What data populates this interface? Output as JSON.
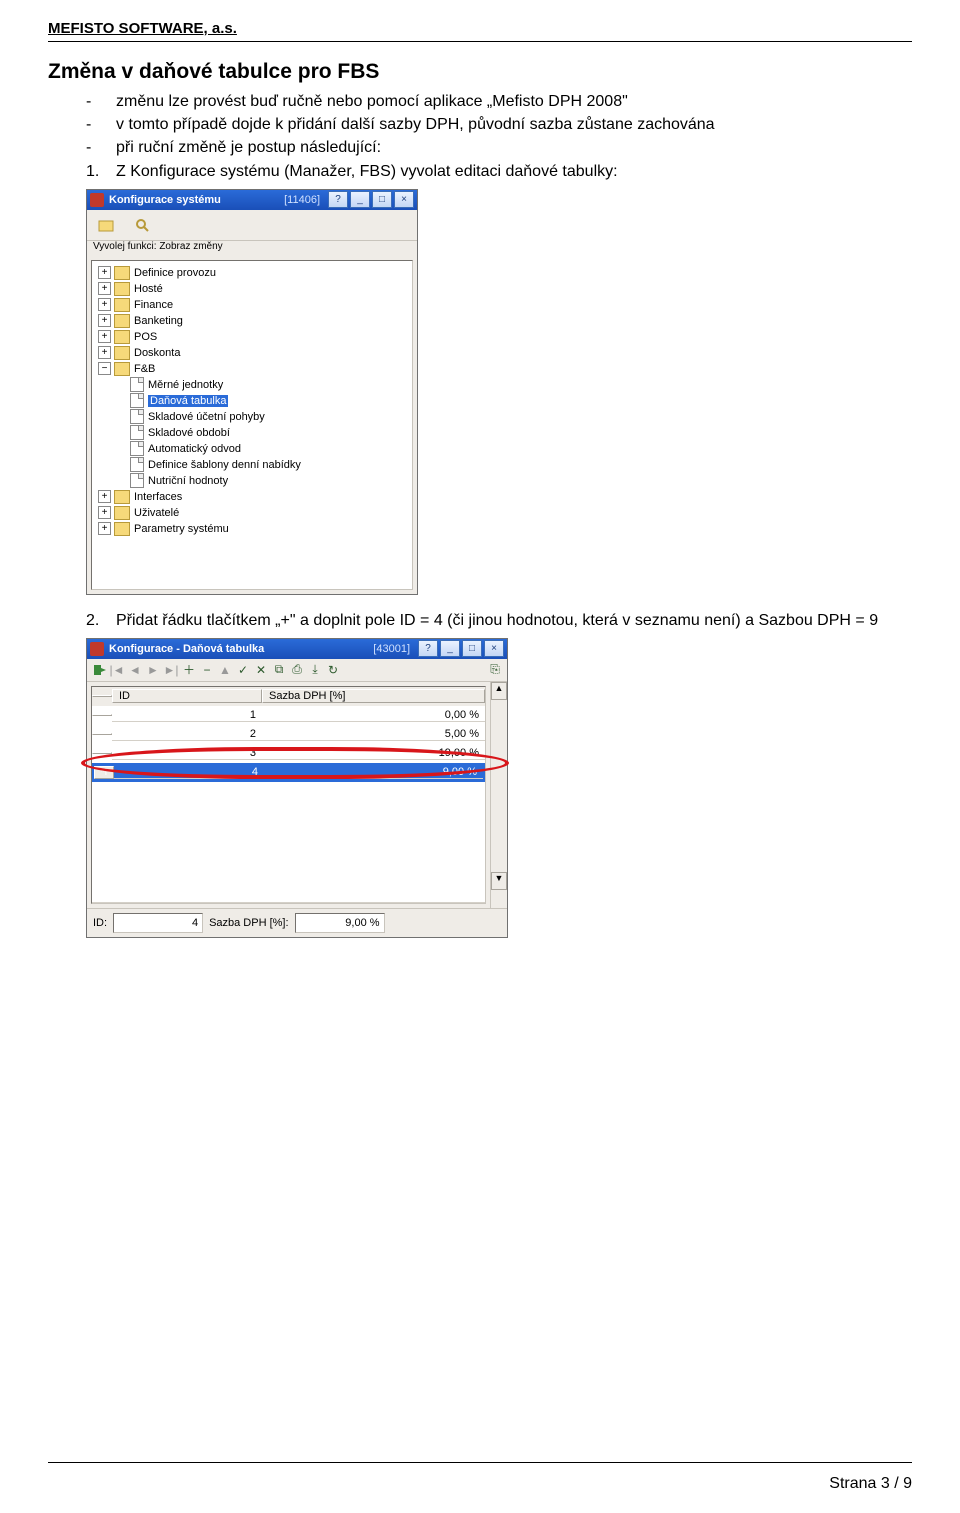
{
  "header": {
    "company": "MEFISTO SOFTWARE, a.s."
  },
  "title": "Změna v daňové tabulce pro FBS",
  "bullets": {
    "b1": "změnu lze provést buď ručně nebo pomocí aplikace „Mefisto DPH 2008\"",
    "b2": "v tomto případě dojde k přidání další sazby DPH, původní sazba zůstane zachována",
    "b3": "při ruční změně je postup následující:"
  },
  "steps": {
    "s1": "Z Konfigurace systému (Manažer, FBS) vyvolat editaci daňové tabulky:",
    "s2": "Přidat řádku tlačítkem „+\" a doplnit pole ID = 4 (či jinou hodnotou, která v seznamu není) a Sazbou DPH = 9"
  },
  "win1": {
    "title": "Konfigurace systému",
    "num": "[11406]",
    "toolbar_label": "Vyvolej funkci: Zobraz změny",
    "tree": {
      "t0": "Definice provozu",
      "t1": "Hosté",
      "t2": "Finance",
      "t3": "Banketing",
      "t4": "POS",
      "t5": "Doskonta",
      "t6": "F&B",
      "t6a": "Měrné jednotky",
      "t6b": "Daňová tabulka",
      "t6c": "Skladové účetní pohyby",
      "t6d": "Skladové období",
      "t6e": "Automatický odvod",
      "t6f": "Definice šablony denní nabídky",
      "t6g": "Nutriční hodnoty",
      "t7": "Interfaces",
      "t8": "Uživatelé",
      "t9": "Parametry systému"
    }
  },
  "win2": {
    "title": "Konfigurace - Daňová tabulka",
    "num": "[43001]",
    "col_id": "ID",
    "col_rate": "Sazba DPH [%]",
    "rows": [
      {
        "id": "1",
        "rate": "0,00 %"
      },
      {
        "id": "2",
        "rate": "5,00 %"
      },
      {
        "id": "3",
        "rate": "19,00 %"
      },
      {
        "id": "4",
        "rate": "9,00 %"
      }
    ],
    "footer_id_lbl": "ID:",
    "footer_id_val": "4",
    "footer_rate_lbl": "Sazba DPH [%]:",
    "footer_rate_val": "9,00 %"
  },
  "footer": {
    "page": "Strana 3 / 9"
  }
}
